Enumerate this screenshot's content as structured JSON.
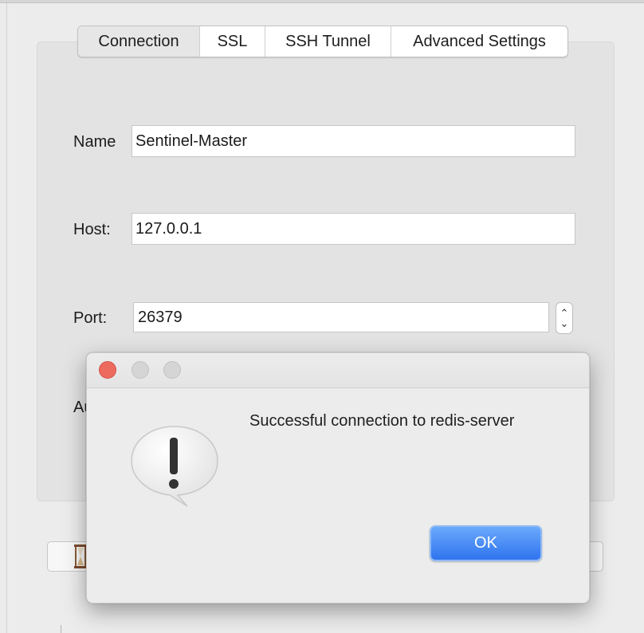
{
  "tabs": [
    {
      "label": "Connection"
    },
    {
      "label": "SSL"
    },
    {
      "label": "SSH Tunnel"
    },
    {
      "label": "Advanced Settings"
    }
  ],
  "form": {
    "name_label": "Name",
    "name_value": "Sentinel-Master",
    "host_label": "Host:",
    "host_value": "127.0.0.1",
    "port_label": "Port:",
    "port_value": "26379",
    "auth_label_partial": "Au"
  },
  "dialog": {
    "message": "Successful connection to redis-server",
    "ok_label": "OK",
    "icon": "exclamation-speech-bubble-icon"
  },
  "colors": {
    "ok_button": "#2f74ef",
    "close_light": "#ec6a5e"
  }
}
